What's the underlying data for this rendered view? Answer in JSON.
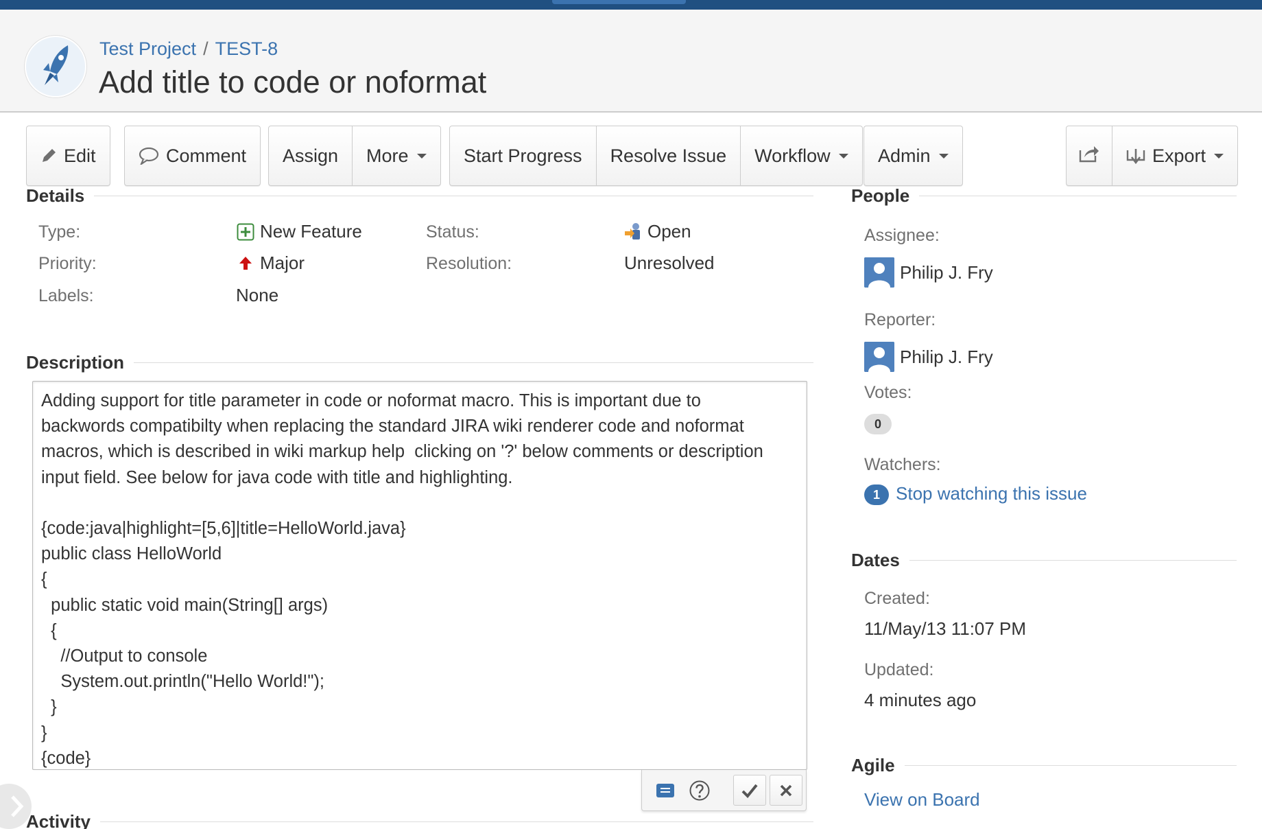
{
  "header": {
    "project": "Test Project",
    "separator": "/",
    "issue_key": "TEST-8",
    "title": "Add title to code or noformat"
  },
  "toolbar": {
    "edit": "Edit",
    "comment": "Comment",
    "assign": "Assign",
    "more": "More",
    "start_progress": "Start Progress",
    "resolve_issue": "Resolve Issue",
    "workflow": "Workflow",
    "admin": "Admin",
    "export": "Export"
  },
  "details": {
    "heading": "Details",
    "type_label": "Type:",
    "type_value": "New Feature",
    "priority_label": "Priority:",
    "priority_value": "Major",
    "labels_label": "Labels:",
    "labels_value": "None",
    "status_label": "Status:",
    "status_value": "Open",
    "resolution_label": "Resolution:",
    "resolution_value": "Unresolved"
  },
  "description": {
    "heading": "Description",
    "text": "Adding support for title parameter in code or noformat macro. This is important due to\nbackwords compatibilty when replacing the standard JIRA wiki renderer code and noformat\nmacros, which is described in wiki markup help  clicking on '?' below comments or description\ninput field. See below for java code with title and highlighting.\n\n{code:java|highlight=[5,6]|title=HelloWorld.java}\npublic class HelloWorld\n{\n  public static void main(String[] args)\n  {\n    //Output to console\n    System.out.println(\"Hello World!\");\n  }\n}\n{code}"
  },
  "activity": {
    "heading": "Activity"
  },
  "people": {
    "heading": "People",
    "assignee_label": "Assignee:",
    "assignee": "Philip J. Fry",
    "reporter_label": "Reporter:",
    "reporter": "Philip J. Fry",
    "votes_label": "Votes:",
    "votes": "0",
    "watchers_label": "Watchers:",
    "watchers_count": "1",
    "watch_link": "Stop watching this issue"
  },
  "dates": {
    "heading": "Dates",
    "created_label": "Created:",
    "created": "11/May/13 11:07 PM",
    "updated_label": "Updated:",
    "updated": "4 minutes ago"
  },
  "agile": {
    "heading": "Agile",
    "link": "View on Board"
  },
  "colors": {
    "topbar": "#205081",
    "link": "#3b73af",
    "header_bg": "#f5f5f5"
  },
  "icons": {
    "project_avatar": "rocket-icon",
    "edit": "pencil-icon",
    "comment": "speech-bubble-icon",
    "share": "share-icon",
    "export": "export-icon",
    "type": "new-feature-icon",
    "priority": "major-priority-icon",
    "status": "open-status-icon",
    "user": "user-avatar-icon",
    "preview": "preview-icon",
    "help": "help-icon",
    "confirm": "checkmark-icon",
    "cancel": "close-icon",
    "expand": "chevron-right-icon"
  }
}
